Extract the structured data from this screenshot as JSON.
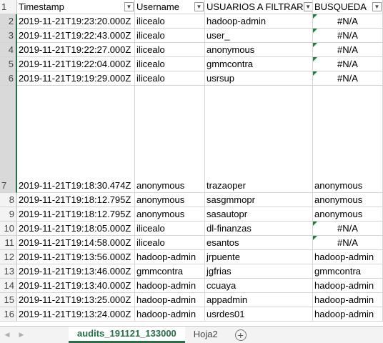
{
  "sheet": {
    "headers": [
      {
        "row_num": "1",
        "label": "Timestamp"
      },
      {
        "label": "Username"
      },
      {
        "label": "USUARIOS A FILTRAR"
      },
      {
        "label": "BUSQUEDA"
      }
    ],
    "rows": [
      {
        "num": "2",
        "timestamp": "2019-11-21T19:23:20.000Z",
        "username": "ilicealo",
        "filtrar": "hadoop-admin",
        "busqueda": "#N/A"
      },
      {
        "num": "3",
        "timestamp": "2019-11-21T19:22:43.000Z",
        "username": "ilicealo",
        "filtrar": "user_",
        "busqueda": "#N/A"
      },
      {
        "num": "4",
        "timestamp": "2019-11-21T19:22:27.000Z",
        "username": "ilicealo",
        "filtrar": "anonymous",
        "busqueda": "#N/A"
      },
      {
        "num": "5",
        "timestamp": "2019-11-21T19:22:04.000Z",
        "username": "ilicealo",
        "filtrar": "gmmcontra",
        "busqueda": "#N/A"
      },
      {
        "num": "6",
        "timestamp": "2019-11-21T19:19:29.000Z",
        "username": "ilicealo",
        "filtrar": "usrsup",
        "busqueda": "#N/A"
      },
      {
        "num": "7",
        "timestamp": "2019-11-21T19:18:30.474Z",
        "username": "anonymous",
        "filtrar": "trazaoper",
        "busqueda": "anonymous"
      },
      {
        "num": "8",
        "timestamp": "2019-11-21T19:18:12.795Z",
        "username": "anonymous",
        "filtrar": "sasgmmopr",
        "busqueda": "anonymous"
      },
      {
        "num": "9",
        "timestamp": "2019-11-21T19:18:12.795Z",
        "username": "anonymous",
        "filtrar": "sasautopr",
        "busqueda": "anonymous"
      },
      {
        "num": "10",
        "timestamp": "2019-11-21T19:18:05.000Z",
        "username": "ilicealo",
        "filtrar": "dl-finanzas",
        "busqueda": "#N/A"
      },
      {
        "num": "11",
        "timestamp": "2019-11-21T19:14:58.000Z",
        "username": "ilicealo",
        "filtrar": "esantos",
        "busqueda": "#N/A"
      },
      {
        "num": "12",
        "timestamp": "2019-11-21T19:13:56.000Z",
        "username": "hadoop-admin",
        "filtrar": "jrpuente",
        "busqueda": "hadoop-admin"
      },
      {
        "num": "13",
        "timestamp": "2019-11-21T19:13:46.000Z",
        "username": "gmmcontra",
        "filtrar": "jgfrias",
        "busqueda": "gmmcontra"
      },
      {
        "num": "14",
        "timestamp": "2019-11-21T19:13:40.000Z",
        "username": "hadoop-admin",
        "filtrar": "ccuaya",
        "busqueda": "hadoop-admin"
      },
      {
        "num": "15",
        "timestamp": "2019-11-21T19:13:25.000Z",
        "username": "hadoop-admin",
        "filtrar": "appadmin",
        "busqueda": "hadoop-admin"
      },
      {
        "num": "16",
        "timestamp": "2019-11-21T19:13:24.000Z",
        "username": "hadoop-admin",
        "filtrar": "usrdes01",
        "busqueda": "hadoop-admin"
      }
    ]
  },
  "tabs": [
    {
      "label": "audits_191121_133000",
      "active": true
    },
    {
      "label": "Hoja2",
      "active": false
    }
  ],
  "icons": {
    "filter": "filter-dropdown-icon",
    "prev": "sheet-prev-icon",
    "next": "sheet-next-icon",
    "add": "add-sheet-icon"
  },
  "colors": {
    "accent": "#217346",
    "error_triangle": "#1f7e3d"
  }
}
